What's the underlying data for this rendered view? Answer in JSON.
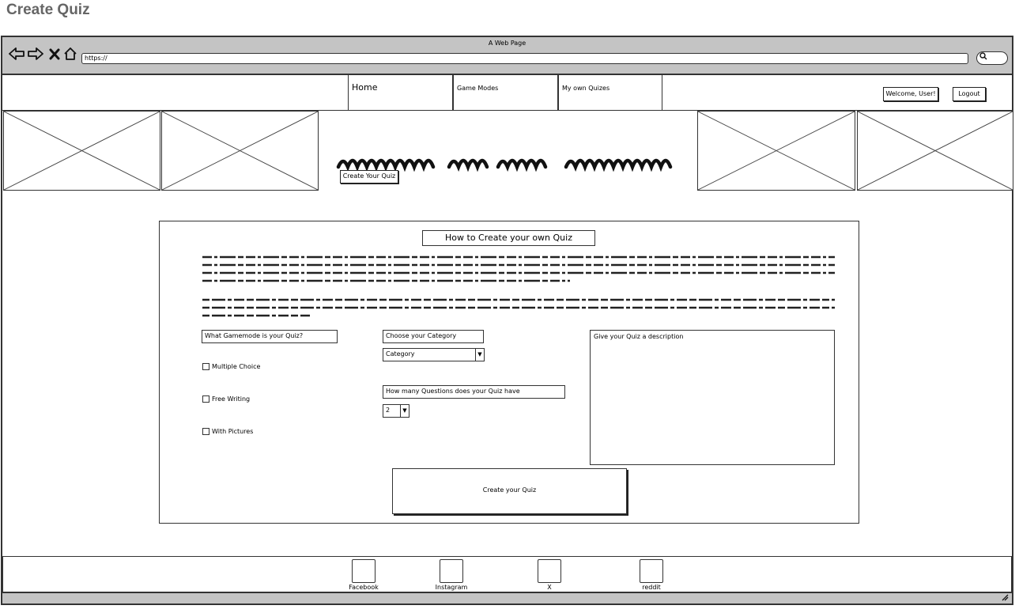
{
  "page": {
    "caption": "Create Quiz"
  },
  "browser": {
    "title": "A Web Page",
    "url": "https://",
    "icons": [
      "back-arrow-icon",
      "forward-arrow-icon",
      "close-x-icon",
      "home-icon",
      "search-icon"
    ]
  },
  "nav": {
    "tabs": [
      {
        "label": "Home"
      },
      {
        "label": "Game Modes"
      },
      {
        "label": "My own Quizes"
      }
    ],
    "welcome": "Welcome, User!",
    "logout": "Logout"
  },
  "hero": {
    "cta": "Create Your Quiz"
  },
  "card": {
    "title": "How to Create your own Quiz",
    "gamemode_label": "What Gamemode is your Quiz?",
    "gamemodes": [
      {
        "label": "Multiple Choice",
        "checked": false
      },
      {
        "label": "Free Writing",
        "checked": false
      },
      {
        "label": "With Pictures",
        "checked": false
      }
    ],
    "category_label": "Choose your Category",
    "category_value": "Category",
    "questions_label": "How many Questions does your Quiz have",
    "questions_value": "2",
    "description_placeholder": "Give your Quiz a description",
    "submit": "Create your Quiz"
  },
  "footer": {
    "links": [
      {
        "label": "Facebook"
      },
      {
        "label": "Instagram"
      },
      {
        "label": "X"
      },
      {
        "label": "reddit"
      }
    ]
  }
}
